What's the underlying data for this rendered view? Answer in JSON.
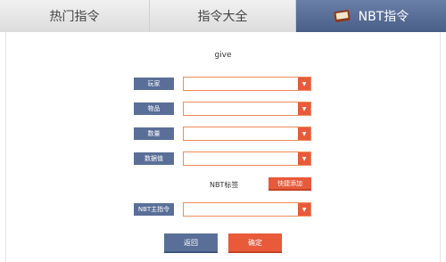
{
  "tabs": [
    {
      "label": "热门指令"
    },
    {
      "label": "指令大全"
    },
    {
      "label": "NBT指令",
      "icon": "book-icon",
      "active": true
    }
  ],
  "command": {
    "name": "give"
  },
  "fields": [
    {
      "label": "玩家",
      "value": ""
    },
    {
      "label": "物品",
      "value": ""
    },
    {
      "label": "数量",
      "value": ""
    },
    {
      "label": "数据值",
      "value": ""
    }
  ],
  "nbt": {
    "label": "NBT标签",
    "quick_add": "快捷添加"
  },
  "nbt_main": {
    "label": "NBT主指令",
    "value": ""
  },
  "arrow_glyph": "▼",
  "buttons": {
    "back": "返回",
    "ok": "确定"
  },
  "colors": {
    "accent_blue": "#5a6f98",
    "accent_orange": "#e85a3a"
  }
}
